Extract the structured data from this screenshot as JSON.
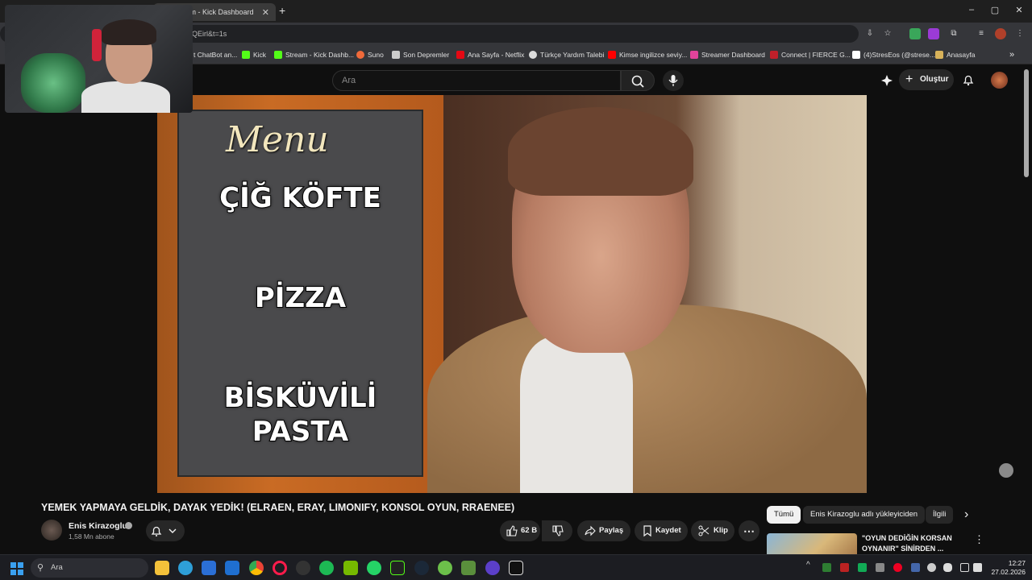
{
  "browser": {
    "tabs": [
      {
        "label": "Stream - Kick Dashboard",
        "active": true
      }
    ],
    "new_tab_label": "+",
    "window_controls": [
      "–",
      "▢",
      "✕"
    ],
    "url_fragment": "QEirl&t=1s",
    "bookmarks": [
      {
        "label": "t ChatBot an...",
        "icon": "chatbot-icon",
        "color": "#6a6a6a"
      },
      {
        "label": "Kick",
        "icon": "kick-icon",
        "color": "#53fc18"
      },
      {
        "label": "Stream - Kick Dashb...",
        "icon": "kick-icon",
        "color": "#53fc18"
      },
      {
        "label": "Suno",
        "icon": "suno-icon",
        "color": "#f06a3a"
      },
      {
        "label": "Son Depremler",
        "icon": "earthquake-icon",
        "color": "#cccccc"
      },
      {
        "label": "Ana Sayfa - Netflix",
        "icon": "netflix-icon",
        "color": "#e50914"
      },
      {
        "label": "Türkçe Yardım Talebi",
        "icon": "help-icon",
        "color": "#dddddd"
      },
      {
        "label": "Kimse ingilizce seviy...",
        "icon": "youtube-icon",
        "color": "#ff0000"
      },
      {
        "label": "Streamer Dashboard",
        "icon": "dashboard-icon",
        "color": "#e0439a"
      },
      {
        "label": "Connect | FIERCE G...",
        "icon": "fierce-icon",
        "color": "#c0202a"
      },
      {
        "label": "(4)StresEos (@strese...",
        "icon": "tiktok-icon",
        "color": "#ffffff"
      },
      {
        "label": "Anasayfa",
        "icon": "home-icon",
        "color": "#d8b25a"
      }
    ],
    "more_bookmarks_label": "»"
  },
  "youtube": {
    "search_placeholder": "Ara",
    "create_label": "Oluştur"
  },
  "video_overlay": {
    "menu_title": "Menu",
    "items": [
      "ÇİĞ KÖFTE",
      "PİZZA",
      "BİSKÜVİLİ",
      "PASTA"
    ]
  },
  "video": {
    "title": "YEMEK YAPMAYA GELDİK, DAYAK YEDİK! (ELRAEN, ERAY, LIMONIFY, KONSOL OYUN, RRAENEE)",
    "channel": "Enis Kirazoglu",
    "subscribers": "1,58 Mn abone",
    "likes": "62 B",
    "share_label": "Paylaş",
    "save_label": "Kaydet",
    "clip_label": "Klip"
  },
  "recommendations": {
    "chips": [
      "Tümü",
      "Enis Kirazoglu adlı yükleyiciden",
      "İlgili"
    ],
    "selected_chip": "Tümü",
    "first_title": "\"OYUN DEDİĞİN KORSAN OYNANIR\" SİNİRDEN ..."
  },
  "taskbar": {
    "search_placeholder": "Ara",
    "time": "12:27",
    "date": "27.02.2026"
  },
  "colors": {
    "background": "#0f0f0f",
    "chip_bg": "#272727",
    "text": "#f1f1f1",
    "secondary_text": "#aaaaaa"
  }
}
